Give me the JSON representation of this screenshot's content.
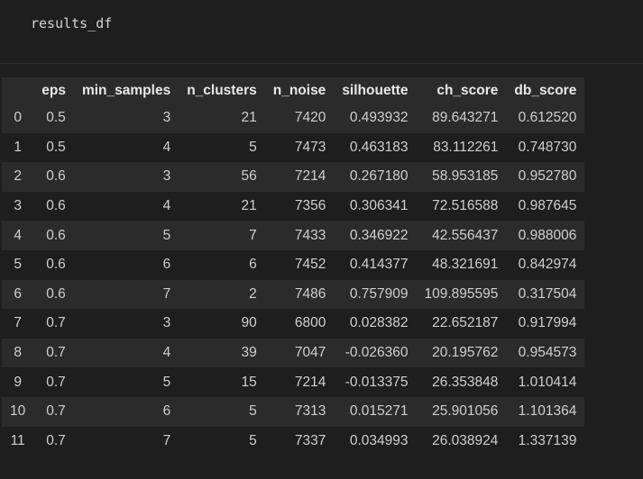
{
  "input_cell": {
    "code": "results_df"
  },
  "output_table": {
    "columns": [
      "",
      "eps",
      "min_samples",
      "n_clusters",
      "n_noise",
      "silhouette",
      "ch_score",
      "db_score"
    ],
    "rows": [
      [
        "0",
        "0.5",
        "3",
        "21",
        "7420",
        "0.493932",
        "89.643271",
        "0.612520"
      ],
      [
        "1",
        "0.5",
        "4",
        "5",
        "7473",
        "0.463183",
        "83.112261",
        "0.748730"
      ],
      [
        "2",
        "0.6",
        "3",
        "56",
        "7214",
        "0.267180",
        "58.953185",
        "0.952780"
      ],
      [
        "3",
        "0.6",
        "4",
        "21",
        "7356",
        "0.306341",
        "72.516588",
        "0.987645"
      ],
      [
        "4",
        "0.6",
        "5",
        "7",
        "7433",
        "0.346922",
        "42.556437",
        "0.988006"
      ],
      [
        "5",
        "0.6",
        "6",
        "6",
        "7452",
        "0.414377",
        "48.321691",
        "0.842974"
      ],
      [
        "6",
        "0.6",
        "7",
        "2",
        "7486",
        "0.757909",
        "109.895595",
        "0.317504"
      ],
      [
        "7",
        "0.7",
        "3",
        "90",
        "6800",
        "0.028382",
        "22.652187",
        "0.917994"
      ],
      [
        "8",
        "0.7",
        "4",
        "39",
        "7047",
        "-0.026360",
        "20.195762",
        "0.954573"
      ],
      [
        "9",
        "0.7",
        "5",
        "15",
        "7214",
        "-0.013375",
        "26.353848",
        "1.010414"
      ],
      [
        "10",
        "0.7",
        "6",
        "5",
        "7313",
        "0.015271",
        "25.901056",
        "1.101364"
      ],
      [
        "11",
        "0.7",
        "7",
        "5",
        "7337",
        "0.034993",
        "26.038924",
        "1.337139"
      ]
    ]
  }
}
